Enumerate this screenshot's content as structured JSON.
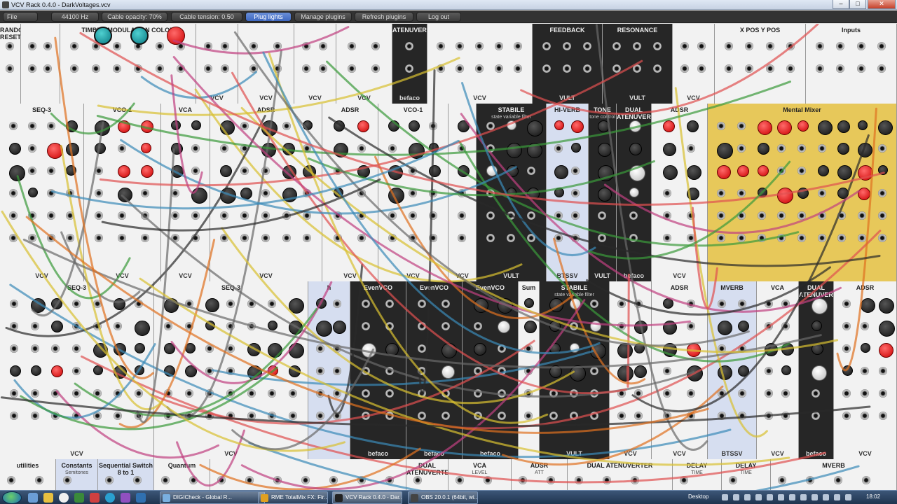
{
  "window": {
    "title": "VCV Rack 0.4.0 - DarkVoltages.vcv",
    "minimize": "–",
    "maximize": "□",
    "close": "✕"
  },
  "toolbar": {
    "file_menu": "File",
    "sample_rate": "44100 Hz",
    "cable_opacity": "Cable opacity: 70%",
    "cable_tension": "Cable tension: 0.50",
    "plug_lights": "Plug lights",
    "manage_plugins": "Manage plugins",
    "refresh_plugins": "Refresh plugins",
    "log_out": "Log out"
  },
  "rack": {
    "row1": [
      {
        "name": "RANDOM RESET",
        "footer": ""
      },
      {
        "name": "",
        "footer": ""
      },
      {
        "name": "TIMBRE MODULATION COLOR",
        "footer": ""
      },
      {
        "name": "",
        "footer": "VCV"
      },
      {
        "name": "",
        "footer": "VCV"
      },
      {
        "name": "",
        "footer": "VCV"
      },
      {
        "name": "",
        "footer": "VCV"
      },
      {
        "name": "ATENUVERTER",
        "footer": "befaco"
      },
      {
        "name": "",
        "footer": "VCV"
      },
      {
        "name": "FEEDBACK",
        "footer": "VULT"
      },
      {
        "name": "RESONANCE",
        "footer": "VULT"
      },
      {
        "name": "",
        "footer": "VCV"
      },
      {
        "name": "X POS  Y POS",
        "footer": ""
      },
      {
        "name": "Inputs",
        "footer": ""
      }
    ],
    "row2": [
      {
        "name": "SEQ-3",
        "footer": "VCV"
      },
      {
        "name": "VCO-1",
        "footer": "VCV"
      },
      {
        "name": "VCA",
        "footer": "VCV"
      },
      {
        "name": "ADSR",
        "footer": "VCV"
      },
      {
        "name": "ADSR",
        "footer": "VCV"
      },
      {
        "name": "VCO-1",
        "footer": "VCV"
      },
      {
        "name": "",
        "footer": "VCV"
      },
      {
        "name": "STABILE",
        "sub": "state variable filter",
        "footer": "VULT"
      },
      {
        "name": "HI-VERB",
        "footer": "BTSSV"
      },
      {
        "name": "TONE",
        "sub": "tone control",
        "footer": "VULT"
      },
      {
        "name": "DUAL ATENUVERTER",
        "footer": "befaco"
      },
      {
        "name": "ADSR",
        "footer": "VCV"
      },
      {
        "name": "Mental Mixer",
        "footer": ""
      }
    ],
    "row3": [
      {
        "name": "SEQ-3",
        "footer": "VCV"
      },
      {
        "name": "SEQ-3",
        "footer": "VCV"
      },
      {
        "name": "h",
        "footer": ""
      },
      {
        "name": "EvenVCO",
        "footer": "befaco"
      },
      {
        "name": "EvenVCO",
        "footer": "befaco"
      },
      {
        "name": "EvenVCO",
        "footer": "befaco"
      },
      {
        "name": "Sum",
        "footer": ""
      },
      {
        "name": "STABILE",
        "sub": "state variable filter",
        "footer": "VULT"
      },
      {
        "name": "",
        "footer": "VCV"
      },
      {
        "name": "ADSR",
        "footer": "VCV"
      },
      {
        "name": "MVERB",
        "footer": "BTSSV"
      },
      {
        "name": "VCA",
        "footer": "VCV"
      },
      {
        "name": "DUAL ATENUVERTER",
        "footer": "befaco"
      },
      {
        "name": "ADSR",
        "footer": "VCV"
      }
    ],
    "row4": [
      {
        "name": "utilities",
        "footer": ""
      },
      {
        "name": "Constants",
        "sub": "Semitones",
        "footer": ""
      },
      {
        "name": "Sequential Switch 8 to 1",
        "footer": ""
      },
      {
        "name": "Quantum",
        "footer": ""
      },
      {
        "name": "",
        "footer": ""
      },
      {
        "name": "DUAL ATENUVERTER",
        "footer": ""
      },
      {
        "name": "VCA",
        "sub": "LEVEL",
        "footer": ""
      },
      {
        "name": "ADSR",
        "sub": "ATT",
        "footer": ""
      },
      {
        "name": "DUAL ATENUVERTER",
        "footer": ""
      },
      {
        "name": "DELAY",
        "sub": "TIME",
        "footer": ""
      },
      {
        "name": "DELAY",
        "sub": "TIME",
        "footer": ""
      },
      {
        "name": "MVERB",
        "footer": ""
      }
    ]
  },
  "taskbar": {
    "tasks": [
      {
        "label": "DIGICheck - Global R...",
        "color": "#7ab0e0"
      },
      {
        "label": "RME TotalMix FX: Fir...",
        "color": "#e0a020"
      },
      {
        "label": "VCV Rack 0.4.0 - Dar...",
        "color": "#222222"
      },
      {
        "label": "OBS 20.0.1 (64bit, wi...",
        "color": "#444444"
      }
    ],
    "desktop_label": "Desktop",
    "clock": "18:02"
  },
  "colors": {
    "toolbar_bg": "#333333",
    "active_button": "#4a72c8",
    "module_panel": "#f2f2f2",
    "mental_mixer": "#e7c85a"
  }
}
